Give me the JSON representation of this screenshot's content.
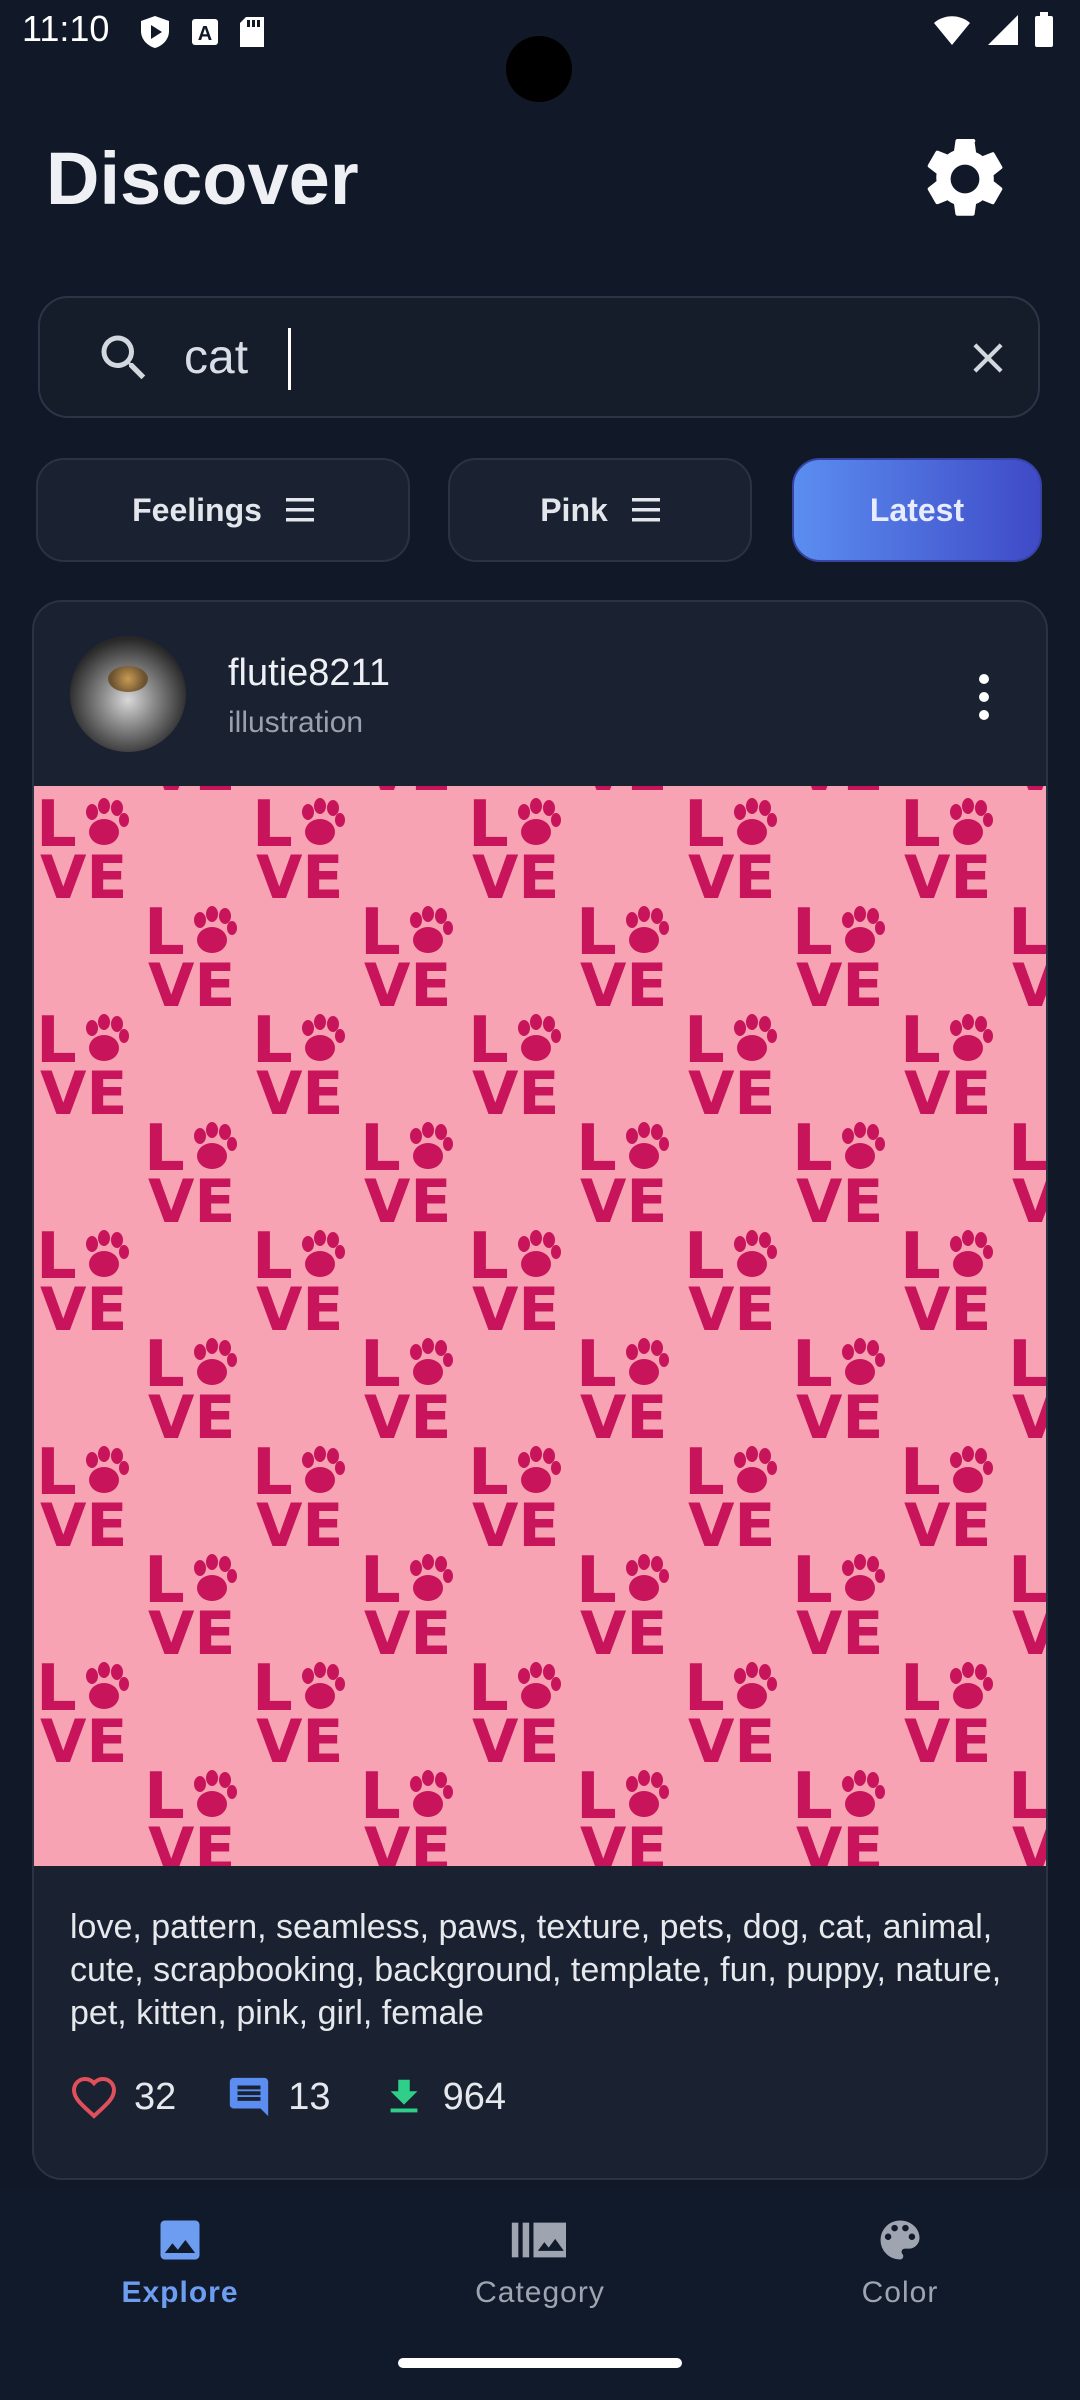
{
  "status_bar": {
    "time": "11:10",
    "left_icons": [
      "play-protect-icon",
      "a-badge-icon",
      "sd-card-icon"
    ],
    "right_icons": [
      "wifi-icon",
      "signal-icon",
      "battery-icon"
    ]
  },
  "header": {
    "title": "Discover",
    "settings_icon": "gear-icon"
  },
  "search": {
    "value": "cat",
    "search_icon": "search-icon",
    "clear_icon": "close-icon"
  },
  "filters": [
    {
      "label": "Feelings",
      "icon": "menu-lines-icon",
      "active": false
    },
    {
      "label": "Pink",
      "icon": "menu-lines-icon",
      "active": false
    },
    {
      "label": "Latest",
      "active": true
    }
  ],
  "post": {
    "username": "flutie8211",
    "category": "illustration",
    "image_pattern": {
      "text_top": "L",
      "text_bottom": "VE",
      "background": "#f7a3b3",
      "foreground": "#c8145a"
    },
    "tags": "love, pattern, seamless, paws, texture, pets, dog, cat, animal, cute, scrapbooking, background, template, fun, puppy, nature, pet, kitten, pink, girl, female",
    "likes": "32",
    "comments": "13",
    "downloads": "964"
  },
  "colors": {
    "background": "#111827",
    "accent": "#5b8ef0",
    "like": "#e0505a",
    "comment": "#5b8ef0",
    "download": "#2fcf8a"
  },
  "bottom_nav": [
    {
      "label": "Explore",
      "icon": "image-icon",
      "active": true
    },
    {
      "label": "Category",
      "icon": "library-icon",
      "active": false
    },
    {
      "label": "Color",
      "icon": "palette-icon",
      "active": false
    }
  ]
}
